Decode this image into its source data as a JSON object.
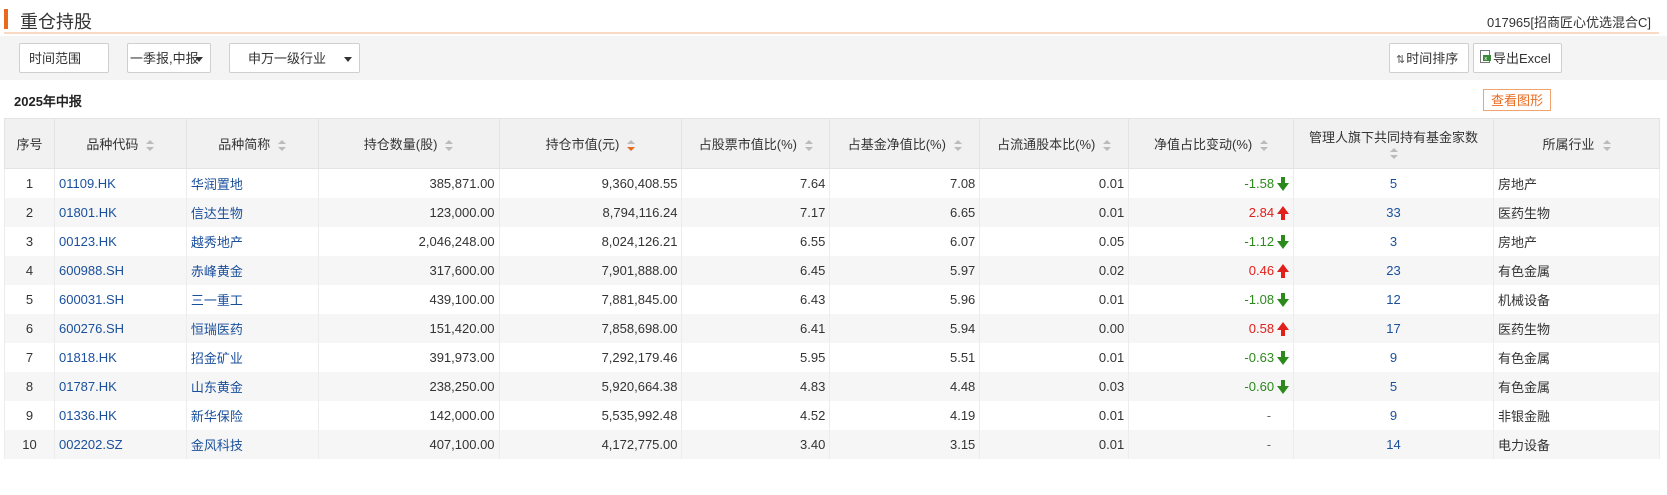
{
  "header": {
    "title": "重仓持股",
    "fund": "017965[招商匠心优选混合C]"
  },
  "toolbar": {
    "time_range": "时间范围",
    "report_select": "一季报,中报",
    "industry_select": "申万一级行业",
    "sort_label": "时间排序",
    "export_label": "导出Excel"
  },
  "subhead": {
    "period": "2025年中报",
    "chart_button": "查看图形"
  },
  "table": {
    "columns": [
      "序号",
      "品种代码",
      "品种简称",
      "持仓数量(股)",
      "持仓市值(元)",
      "占股票市值比(%)",
      "占基金净值比(%)",
      "占流通股本比(%)",
      "净值占比变动(%)",
      "管理人旗下共同持有基金家数",
      "所属行业"
    ],
    "rows": [
      {
        "no": "1",
        "code": "01109.HK",
        "name": "华润置地",
        "qty": "385,871.00",
        "value": "9,360,408.55",
        "stock_pct": "7.64",
        "nav_pct": "7.08",
        "float_pct": "0.01",
        "change": "-1.58",
        "dir": "down",
        "funds": "5",
        "industry": "房地产"
      },
      {
        "no": "2",
        "code": "01801.HK",
        "name": "信达生物",
        "qty": "123,000.00",
        "value": "8,794,116.24",
        "stock_pct": "7.17",
        "nav_pct": "6.65",
        "float_pct": "0.01",
        "change": "2.84",
        "dir": "up",
        "funds": "33",
        "industry": "医药生物"
      },
      {
        "no": "3",
        "code": "00123.HK",
        "name": "越秀地产",
        "qty": "2,046,248.00",
        "value": "8,024,126.21",
        "stock_pct": "6.55",
        "nav_pct": "6.07",
        "float_pct": "0.05",
        "change": "-1.12",
        "dir": "down",
        "funds": "3",
        "industry": "房地产"
      },
      {
        "no": "4",
        "code": "600988.SH",
        "name": "赤峰黄金",
        "qty": "317,600.00",
        "value": "7,901,888.00",
        "stock_pct": "6.45",
        "nav_pct": "5.97",
        "float_pct": "0.02",
        "change": "0.46",
        "dir": "up",
        "funds": "23",
        "industry": "有色金属"
      },
      {
        "no": "5",
        "code": "600031.SH",
        "name": "三一重工",
        "qty": "439,100.00",
        "value": "7,881,845.00",
        "stock_pct": "6.43",
        "nav_pct": "5.96",
        "float_pct": "0.01",
        "change": "-1.08",
        "dir": "down",
        "funds": "12",
        "industry": "机械设备"
      },
      {
        "no": "6",
        "code": "600276.SH",
        "name": "恒瑞医药",
        "qty": "151,420.00",
        "value": "7,858,698.00",
        "stock_pct": "6.41",
        "nav_pct": "5.94",
        "float_pct": "0.00",
        "change": "0.58",
        "dir": "up",
        "funds": "17",
        "industry": "医药生物"
      },
      {
        "no": "7",
        "code": "01818.HK",
        "name": "招金矿业",
        "qty": "391,973.00",
        "value": "7,292,179.46",
        "stock_pct": "5.95",
        "nav_pct": "5.51",
        "float_pct": "0.01",
        "change": "-0.63",
        "dir": "down",
        "funds": "9",
        "industry": "有色金属"
      },
      {
        "no": "8",
        "code": "01787.HK",
        "name": "山东黄金",
        "qty": "238,250.00",
        "value": "5,920,664.38",
        "stock_pct": "4.83",
        "nav_pct": "4.48",
        "float_pct": "0.03",
        "change": "-0.60",
        "dir": "down",
        "funds": "5",
        "industry": "有色金属"
      },
      {
        "no": "9",
        "code": "01336.HK",
        "name": "新华保险",
        "qty": "142,000.00",
        "value": "5,535,992.48",
        "stock_pct": "4.52",
        "nav_pct": "4.19",
        "float_pct": "0.01",
        "change": "-",
        "dir": "none",
        "funds": "9",
        "industry": "非银金融"
      },
      {
        "no": "10",
        "code": "002202.SZ",
        "name": "金风科技",
        "qty": "407,100.00",
        "value": "4,172,775.00",
        "stock_pct": "3.40",
        "nav_pct": "3.15",
        "float_pct": "0.01",
        "change": "-",
        "dir": "none",
        "funds": "14",
        "industry": "电力设备"
      }
    ]
  },
  "colors": {
    "accent": "#e96a1f",
    "link": "#1a4f9c",
    "up": "#e0201b",
    "down": "#2c8a1c"
  }
}
